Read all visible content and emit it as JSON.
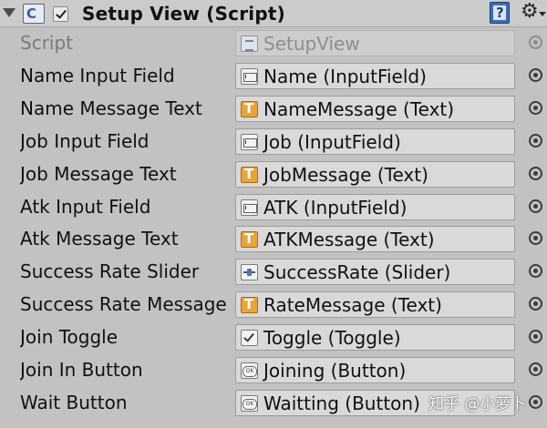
{
  "component": {
    "title": "Setup View (Script)",
    "enabled": true
  },
  "icons": {
    "foldout": "foldout-arrow-icon",
    "script": "cs-script-icon",
    "help": "help-book-icon",
    "settings": "gear-icon",
    "picker": "object-picker-icon"
  },
  "fields": [
    {
      "label": "Script",
      "value": "SetupView",
      "type": "script",
      "disabled": true
    },
    {
      "label": "Name Input Field",
      "value": "Name (InputField)",
      "type": "inputfield"
    },
    {
      "label": "Name Message Text",
      "value": "NameMessage (Text)",
      "type": "text"
    },
    {
      "label": "Job Input Field",
      "value": "Job (InputField)",
      "type": "inputfield"
    },
    {
      "label": "Job Message Text",
      "value": "JobMessage (Text)",
      "type": "text"
    },
    {
      "label": "Atk Input Field",
      "value": "ATK (InputField)",
      "type": "inputfield"
    },
    {
      "label": "Atk Message Text",
      "value": "ATKMessage (Text)",
      "type": "text"
    },
    {
      "label": "Success Rate Slider",
      "value": "SuccessRate (Slider)",
      "type": "slider"
    },
    {
      "label": "Success Rate Message",
      "value": "RateMessage (Text)",
      "type": "text"
    },
    {
      "label": "Join Toggle",
      "value": "Toggle (Toggle)",
      "type": "toggle"
    },
    {
      "label": "Join In Button",
      "value": "Joining (Button)",
      "type": "button"
    },
    {
      "label": "Wait Button",
      "value": "Waitting (Button)",
      "type": "button"
    }
  ],
  "watermark": "知乎 @小萝卜"
}
